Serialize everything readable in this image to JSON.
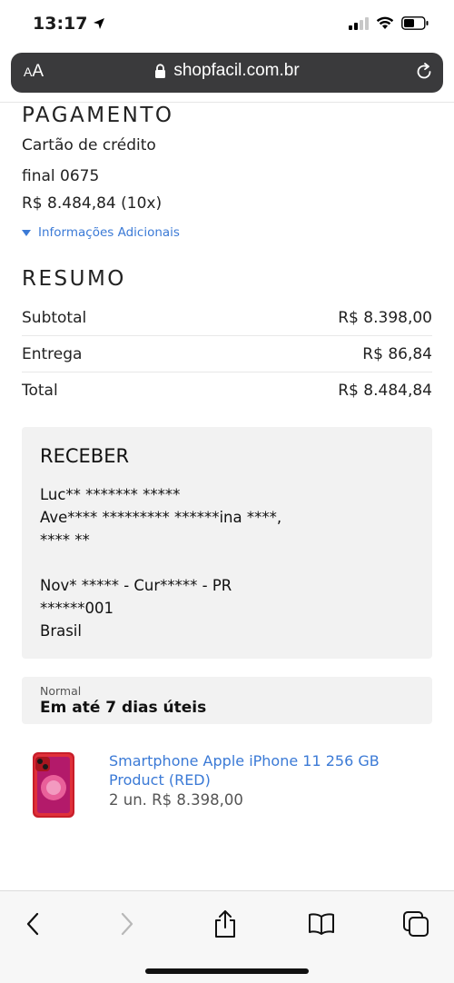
{
  "status": {
    "time": "13:17"
  },
  "browser": {
    "aa_small": "A",
    "aa_big": "A",
    "url": "shopfacil.com.br"
  },
  "payment": {
    "title": "PAGAMENTO",
    "method": "Cartão de crédito",
    "card": "final 0675",
    "amount": "R$ 8.484,84 (10x)",
    "more_info": "Informações Adicionais"
  },
  "summary": {
    "title": "RESUMO",
    "rows": [
      {
        "label": "Subtotal",
        "value": "R$ 8.398,00"
      },
      {
        "label": "Entrega",
        "value": "R$ 86,84"
      },
      {
        "label": "Total",
        "value": "R$ 8.484,84"
      }
    ]
  },
  "receive": {
    "title": "RECEBER",
    "name": "Luc** ******* *****",
    "street": "Ave**** ********* ******ina ****,",
    "street2": "**** **",
    "city": "Nov* ***** - Cur***** - PR",
    "zip": "******001",
    "country": "Brasil"
  },
  "shipping": {
    "type": "Normal",
    "eta": "Em até 7 dias úteis"
  },
  "product": {
    "name": "Smartphone Apple iPhone 11 256 GB Product (RED)",
    "qty_price": "2 un. R$ 8.398,00"
  },
  "colors": {
    "link": "#3b7ad6",
    "address_bar": "#3a3a3c",
    "product_red": "#d8232a"
  },
  "icons": [
    "location-arrow-icon",
    "signal-icon",
    "wifi-icon",
    "battery-icon",
    "lock-icon",
    "reload-icon",
    "chevron-down-icon",
    "back-icon",
    "forward-icon",
    "share-icon",
    "bookmarks-icon",
    "tabs-icon"
  ]
}
